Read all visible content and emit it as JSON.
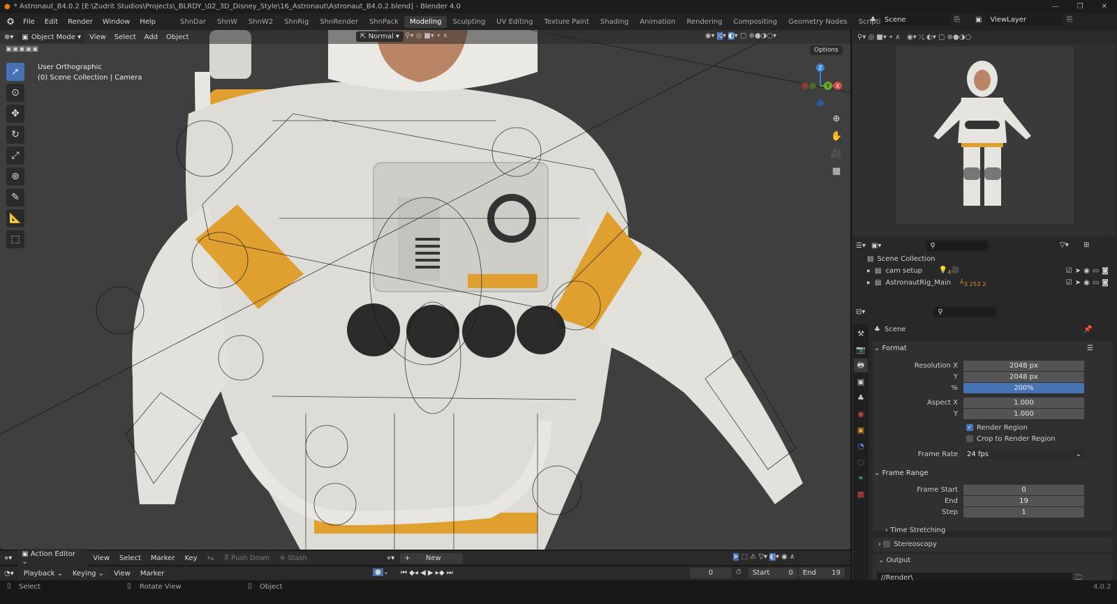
{
  "title": "* Astronaut_B4.0.2 [E:\\Zudrit Studios\\Projects\\_BLRDY_\\02_3D_Disney_Style\\16_Astronaut\\Astronaut_B4.0.2.blend] - Blender 4.0",
  "menu": [
    "File",
    "Edit",
    "Render",
    "Window",
    "Help"
  ],
  "workspaces": [
    "ShnDar",
    "ShnW",
    "ShnW2",
    "ShnRig",
    "ShnRender",
    "ShnPack",
    "Modeling",
    "Sculpting",
    "UV Editing",
    "Texture Paint",
    "Shading",
    "Animation",
    "Rendering",
    "Compositing",
    "Geometry Nodes",
    "Scripting",
    "+"
  ],
  "active_workspace": "Modeling",
  "scene": "Scene",
  "view_layer": "ViewLayer",
  "viewport": {
    "mode": "Object Mode",
    "menus": [
      "View",
      "Select",
      "Add",
      "Object"
    ],
    "orientation": "Normal",
    "options": "Options",
    "view_name": "User Orthographic",
    "collection_info": "(0) Scene Collection | Camera",
    "gizmo": {
      "x": "X",
      "y": "Y",
      "z": "Z"
    }
  },
  "outliner": {
    "root": "Scene Collection",
    "items": [
      {
        "name": "cam setup",
        "badge": "4"
      },
      {
        "name": "AstronautRig_Main",
        "badge": "3 253 2"
      }
    ]
  },
  "properties": {
    "context": "Scene",
    "format": {
      "header": "Format",
      "res_x_label": "Resolution X",
      "res_x": "2048 px",
      "res_y_label": "Y",
      "res_y": "2048 px",
      "pct_label": "%",
      "pct": "200%",
      "aspect_x_label": "Aspect X",
      "aspect_x": "1.000",
      "aspect_y_label": "Y",
      "aspect_y": "1.000",
      "render_region": "Render Region",
      "crop": "Crop to Render Region",
      "frame_rate_label": "Frame Rate",
      "frame_rate": "24 fps"
    },
    "frame_range": {
      "header": "Frame Range",
      "start_label": "Frame Start",
      "start": "0",
      "end_label": "End",
      "end": "19",
      "step_label": "Step",
      "step": "1"
    },
    "time_stretching": "Time Stretching",
    "stereoscopy": "Stereoscopy",
    "output": {
      "header": "Output",
      "path": "//Render\\"
    }
  },
  "action_editor": {
    "mode": "Action Editor",
    "menus": [
      "View",
      "Select",
      "Marker",
      "Key"
    ],
    "push_down": "Push Down",
    "stash": "Stash",
    "new": "New"
  },
  "timeline": {
    "playback": "Playback",
    "keying": "Keying",
    "view": "View",
    "marker": "Marker",
    "current": "0",
    "start_label": "Start",
    "start": "0",
    "end_label": "End",
    "end": "19"
  },
  "status": {
    "select": "Select",
    "rotate": "Rotate View",
    "object": "Object",
    "version": "4.0.2"
  },
  "colors": {
    "accent": "#4772b3",
    "suit": "#e6e4df",
    "orange": "#e0a030"
  }
}
